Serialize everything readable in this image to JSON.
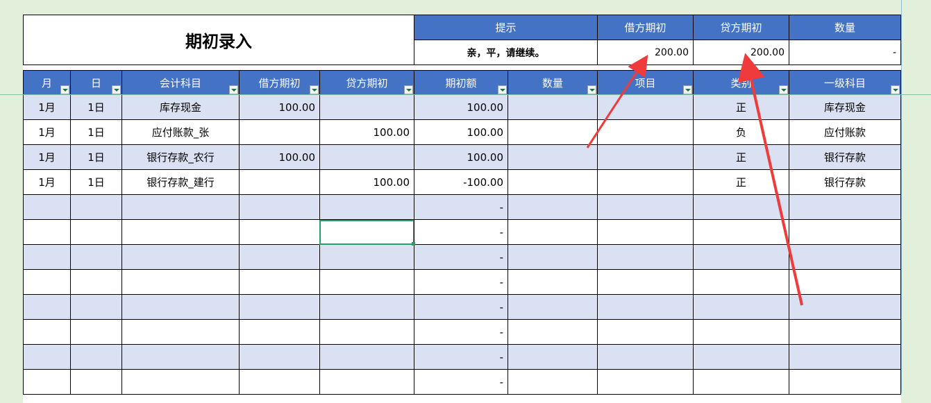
{
  "summary": {
    "title": "期初录入",
    "headers": [
      "提示",
      "借方期初",
      "贷方期初",
      "数量"
    ],
    "values": [
      "亲，平，请继续。",
      "200.00",
      "200.00",
      "-"
    ]
  },
  "table": {
    "headers": [
      "月",
      "日",
      "会计科目",
      "借方期初",
      "贷方期初",
      "期初额",
      "数量",
      "项目",
      "类别",
      "一级科目"
    ],
    "rows": [
      [
        "1月",
        "1日",
        "库存现金",
        "100.00",
        "",
        "100.00",
        "",
        "",
        "正",
        "库存现金"
      ],
      [
        "1月",
        "1日",
        "应付账款_张",
        "",
        "100.00",
        "100.00",
        "",
        "",
        "负",
        "应付账款"
      ],
      [
        "1月",
        "1日",
        "银行存款_农行",
        "100.00",
        "",
        "100.00",
        "",
        "",
        "正",
        "银行存款"
      ],
      [
        "1月",
        "1日",
        "银行存款_建行",
        "",
        "100.00",
        "-100.00",
        "",
        "",
        "正",
        "银行存款"
      ],
      [
        "",
        "",
        "",
        "",
        "",
        "-",
        "",
        "",
        "",
        ""
      ],
      [
        "",
        "",
        "",
        "",
        "",
        "-",
        "",
        "",
        "",
        ""
      ],
      [
        "",
        "",
        "",
        "",
        "",
        "-",
        "",
        "",
        "",
        ""
      ],
      [
        "",
        "",
        "",
        "",
        "",
        "-",
        "",
        "",
        "",
        ""
      ],
      [
        "",
        "",
        "",
        "",
        "",
        "-",
        "",
        "",
        "",
        ""
      ],
      [
        "",
        "",
        "",
        "",
        "",
        "-",
        "",
        "",
        "",
        ""
      ],
      [
        "",
        "",
        "",
        "",
        "",
        "-",
        "",
        "",
        "",
        ""
      ],
      [
        "",
        "",
        "",
        "",
        "",
        "-",
        "",
        "",
        "",
        ""
      ]
    ]
  },
  "colors": {
    "header_blue": "#4472c4",
    "band_blue": "#d9e1f2",
    "sheet_bg": "#e2efda",
    "arrow_red": "#ef3b3b",
    "selection_green": "#21a366"
  }
}
